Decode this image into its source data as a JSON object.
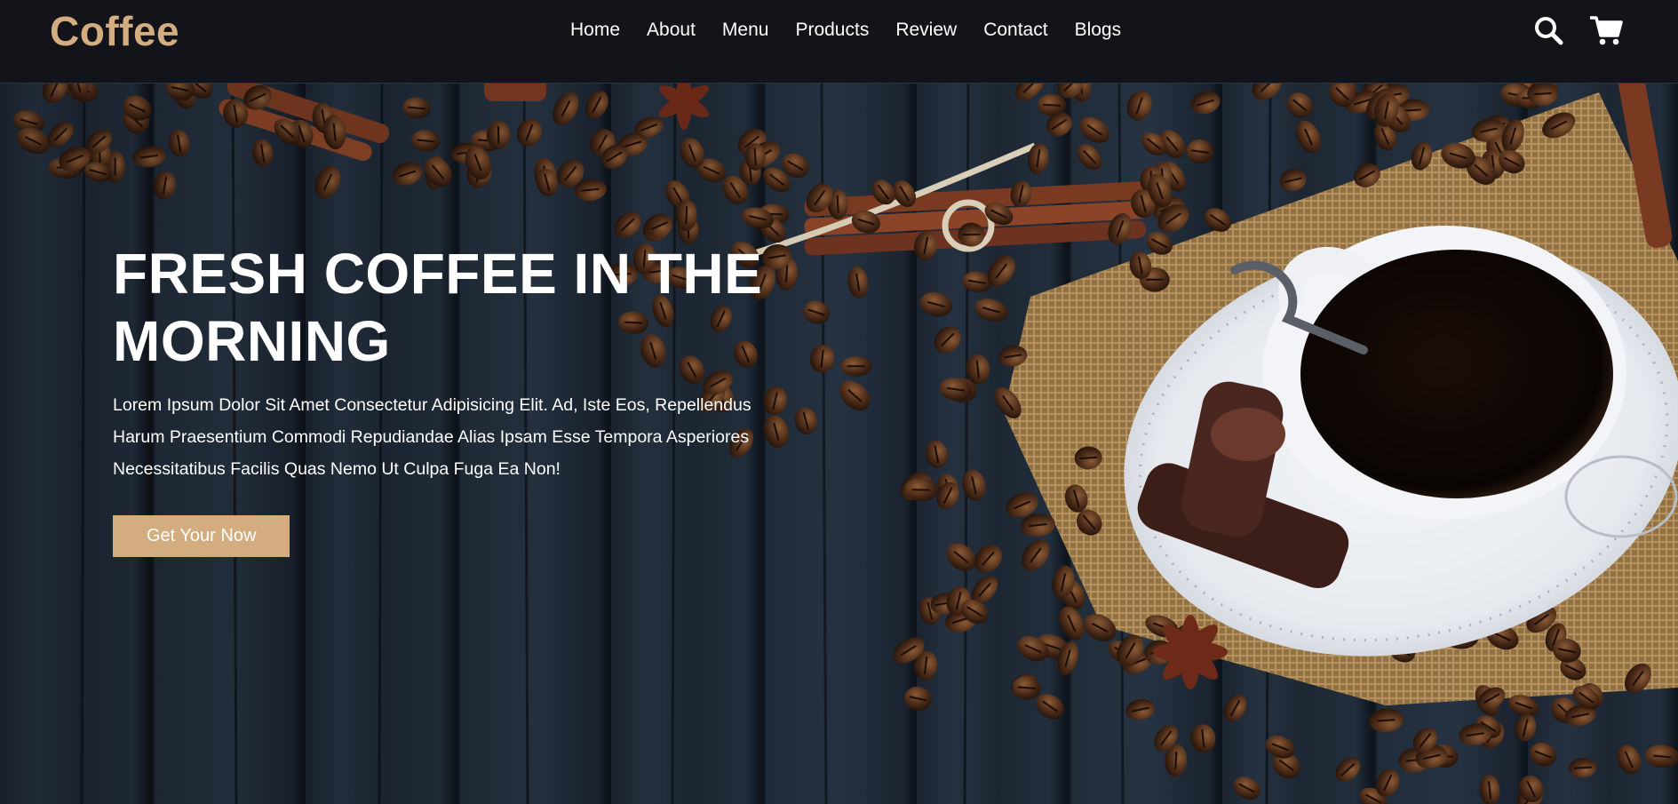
{
  "brand": {
    "logo": "Coffee",
    "accent": "#d3ad7f"
  },
  "nav": {
    "items": [
      {
        "label": "Home"
      },
      {
        "label": "About"
      },
      {
        "label": "Menu"
      },
      {
        "label": "Products"
      },
      {
        "label": "Review"
      },
      {
        "label": "Contact"
      },
      {
        "label": "Blogs"
      }
    ]
  },
  "header_icons": {
    "search": "search-icon",
    "cart": "cart-icon"
  },
  "hero": {
    "title": "FRESH COFFEE IN THE MORNING",
    "description": "Lorem Ipsum Dolor Sit Amet Consectetur Adipisicing Elit. Ad, Iste Eos, Repellendus Harum Praesentium Commodi Repudiandae Alias Ipsam Esse Tempora Asperiores Necessitatibus Facilis Quas Nemo Ut Culpa Fuga Ea Non!",
    "cta_label": "Get Your Now",
    "background_image": "coffee-cup-beans-wood"
  }
}
